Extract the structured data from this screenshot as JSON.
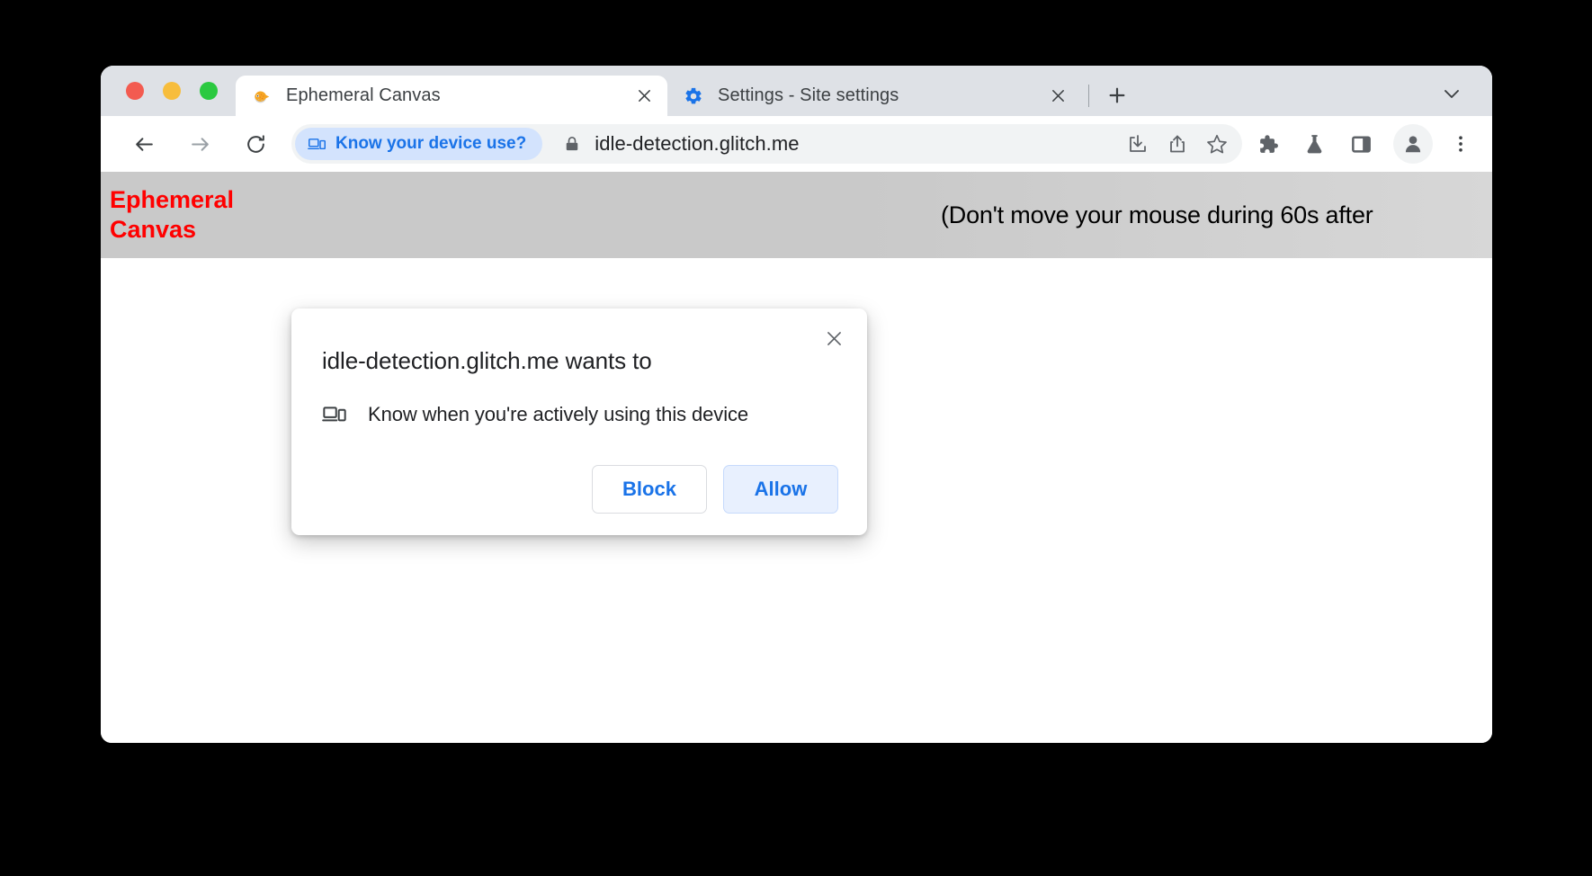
{
  "window": {
    "traffic_lights": [
      {
        "name": "close",
        "color": "#f35b50"
      },
      {
        "name": "minimize",
        "color": "#f7bd3c"
      },
      {
        "name": "maximize",
        "color": "#2bc940"
      }
    ]
  },
  "tabs": [
    {
      "title": "Ephemeral Canvas",
      "favicon": "pufferfish-icon",
      "favicon_glyph": "🐡",
      "active": true,
      "close_label": "close-tab"
    },
    {
      "title": "Settings - Site settings",
      "favicon": "gear-icon",
      "favicon_glyph": "",
      "active": false,
      "close_label": "close-tab"
    }
  ],
  "tabstrip": {
    "new_tab_label": "New Tab",
    "tab_list_label": "Search tabs"
  },
  "toolbar": {
    "back_label": "Back",
    "forward_label": "Forward",
    "reload_label": "Reload",
    "download_label": "Downloads",
    "share_label": "Share this page",
    "bookmark_label": "Bookmark this tab",
    "extensions_label": "Extensions",
    "experiments_label": "Experiments",
    "side_panel_label": "Side panel",
    "profile_label": "Profile",
    "menu_label": "Customize and control Google Chrome"
  },
  "omnibox": {
    "permission_chip": {
      "label": "Know your device use?",
      "icon": "device-idle-icon",
      "text_color": "#1a73e8",
      "background": "#d3e3fd"
    },
    "lock_icon": "lock-icon",
    "url": "idle-detection.glitch.me"
  },
  "page": {
    "heading": "Ephemeral Canvas",
    "heading_color": "#ff0000",
    "subtitle": "(Don't move your mouse during 60s after",
    "banner_color": "#c9c9c9"
  },
  "dialog": {
    "title": "idle-detection.glitch.me wants to",
    "permission_icon": "device-idle-icon",
    "permission_text": "Know when you're actively using this device",
    "close_icon": "close-icon",
    "buttons": {
      "block": "Block",
      "allow": "Allow"
    },
    "accent_color": "#1a73e8",
    "allow_background": "#e8f0fe"
  }
}
